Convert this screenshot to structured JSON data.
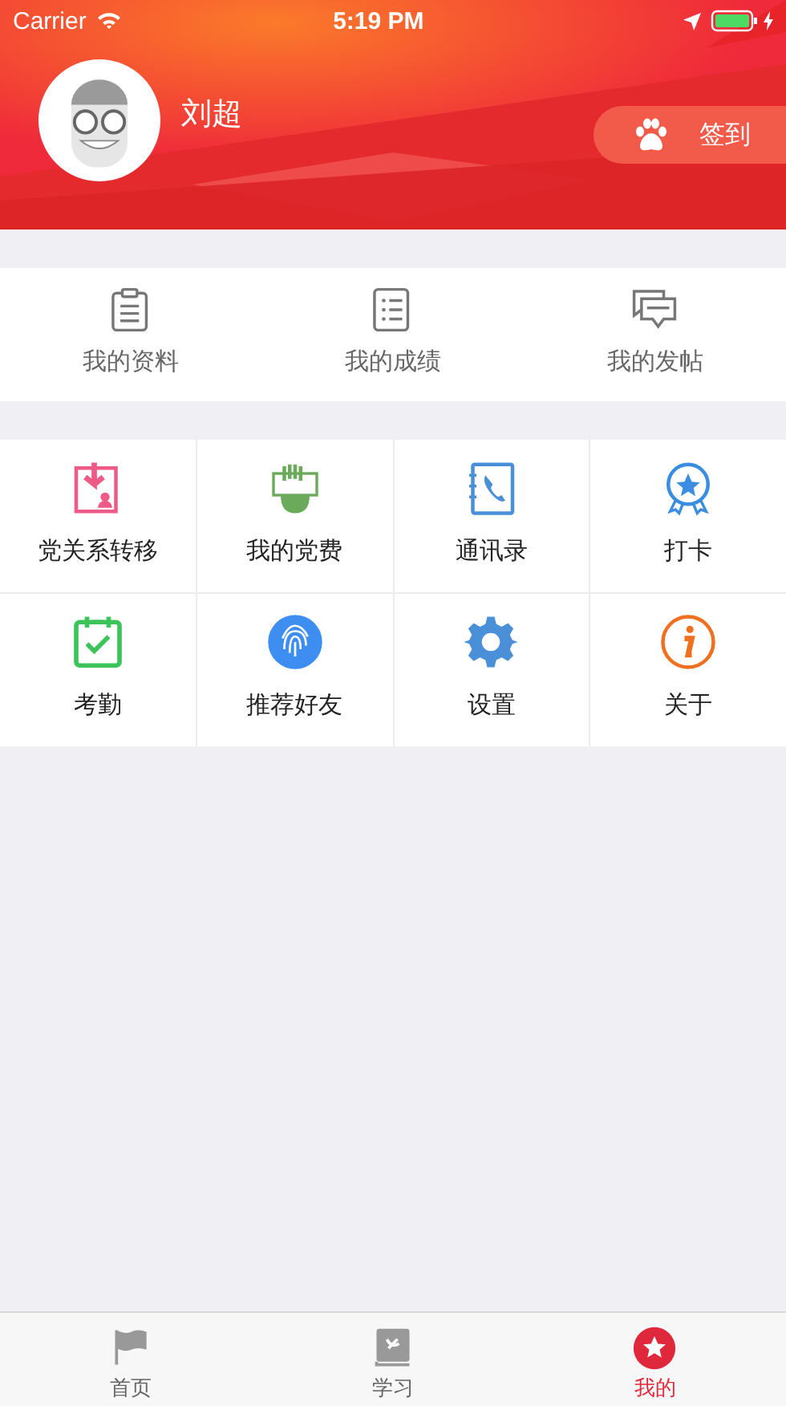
{
  "status_bar": {
    "carrier": "Carrier",
    "time": "5:19 PM"
  },
  "profile": {
    "name": "刘超",
    "checkin_button": "签到"
  },
  "quick_links": [
    {
      "label": "我的资料"
    },
    {
      "label": "我的成绩"
    },
    {
      "label": "我的发帖"
    }
  ],
  "features": [
    {
      "label": "党关系转移"
    },
    {
      "label": "我的党费"
    },
    {
      "label": "通讯录"
    },
    {
      "label": "打卡"
    },
    {
      "label": "考勤"
    },
    {
      "label": "推荐好友"
    },
    {
      "label": "设置"
    },
    {
      "label": "关于"
    }
  ],
  "tab_bar": [
    {
      "label": "首页",
      "selected": false
    },
    {
      "label": "学习",
      "selected": false
    },
    {
      "label": "我的",
      "selected": true
    }
  ]
}
